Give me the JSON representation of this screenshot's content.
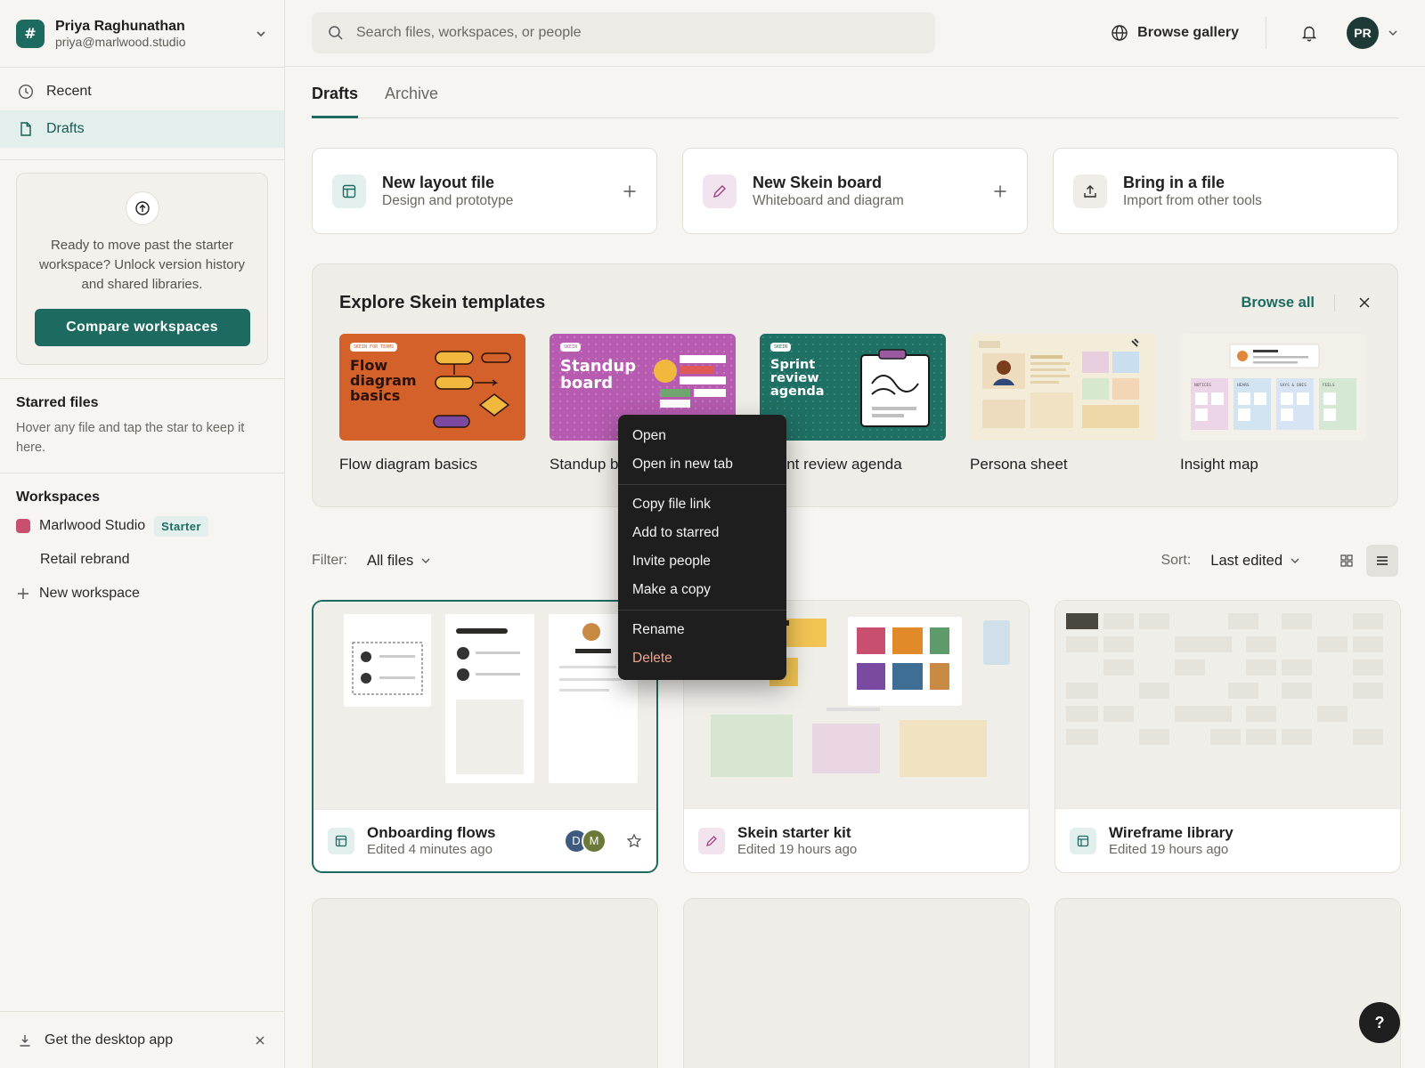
{
  "account": {
    "name": "Priya Raghunathan",
    "email": "priya@marlwood.studio"
  },
  "nav": {
    "items": [
      {
        "label": "Recent",
        "icon": "clock-icon"
      },
      {
        "label": "Drafts",
        "icon": "file-icon",
        "active": true
      }
    ]
  },
  "promo": {
    "text": "Ready to move past the starter workspace? Unlock version history and shared libraries.",
    "button": "Compare workspaces"
  },
  "starred": {
    "title": "Starred files",
    "subtitle": "Hover any file and tap the star to keep it here."
  },
  "workspaces": {
    "title": "Workspaces",
    "items": [
      {
        "name": "Marlwood Studio",
        "badge": "Starter",
        "color": "#c94f70"
      },
      {
        "name": "Retail rebrand"
      }
    ],
    "new_label": "New workspace"
  },
  "desktop_app": {
    "label": "Get the desktop app"
  },
  "search": {
    "placeholder": "Search files, workspaces, or people"
  },
  "topbar": {
    "browse_gallery": "Browse gallery",
    "avatar_initials": "PR"
  },
  "tabs": [
    {
      "label": "Drafts",
      "active": true
    },
    {
      "label": "Archive"
    }
  ],
  "create_cards": [
    {
      "title": "New layout file",
      "subtitle": "Design and prototype",
      "icon": "layout-icon"
    },
    {
      "title": "New Skein board",
      "subtitle": "Whiteboard and diagram",
      "icon": "pencil-icon"
    },
    {
      "title": "Bring in a file",
      "subtitle": "Import from other tools",
      "icon": "upload-icon"
    }
  ],
  "templates": {
    "title": "Explore Skein templates",
    "browse_all": "Browse all",
    "items": [
      {
        "name": "Flow diagram basics",
        "thumb_title": "Flow diagram basics",
        "thumb_tag": "SKEIN FOR TEAMS",
        "bg": "#d4602a"
      },
      {
        "name": "Standup board",
        "thumb_title": "Standup board",
        "thumb_tag": "SKEIN",
        "bg": "#b65bb0"
      },
      {
        "name": "Sprint review agenda",
        "thumb_title": "Sprint review agenda",
        "thumb_tag": "SKEIN",
        "bg": "#1f7064"
      },
      {
        "name": "Persona sheet",
        "bg": "#f3ecd9"
      },
      {
        "name": "Insight map",
        "bg": "#f3f0ea",
        "col_labels": [
          "NOTICES",
          "HEARS",
          "SAYS & DOES",
          "FEELS"
        ]
      }
    ]
  },
  "toolbar": {
    "filter_label": "Filter:",
    "filter_value": "All files",
    "sort_label": "Sort:",
    "sort_value": "Last edited"
  },
  "files": [
    {
      "name": "Onboarding flows",
      "edited": "Edited 4 minutes ago",
      "collaborators": [
        "D",
        "M"
      ],
      "selected": true
    },
    {
      "name": "Skein starter kit",
      "edited": "Edited 19 hours ago"
    },
    {
      "name": "Wireframe library",
      "edited": "Edited 19 hours ago"
    }
  ],
  "context_menu": {
    "groups": [
      [
        "Open",
        "Open in new tab"
      ],
      [
        "Copy file link",
        "Add to starred",
        "Invite people",
        "Make a copy"
      ],
      [
        "Rename",
        "Delete"
      ]
    ]
  },
  "help": {
    "label": "?"
  },
  "colors": {
    "accent": "#1d6b60",
    "danger": "#f0a38c"
  }
}
